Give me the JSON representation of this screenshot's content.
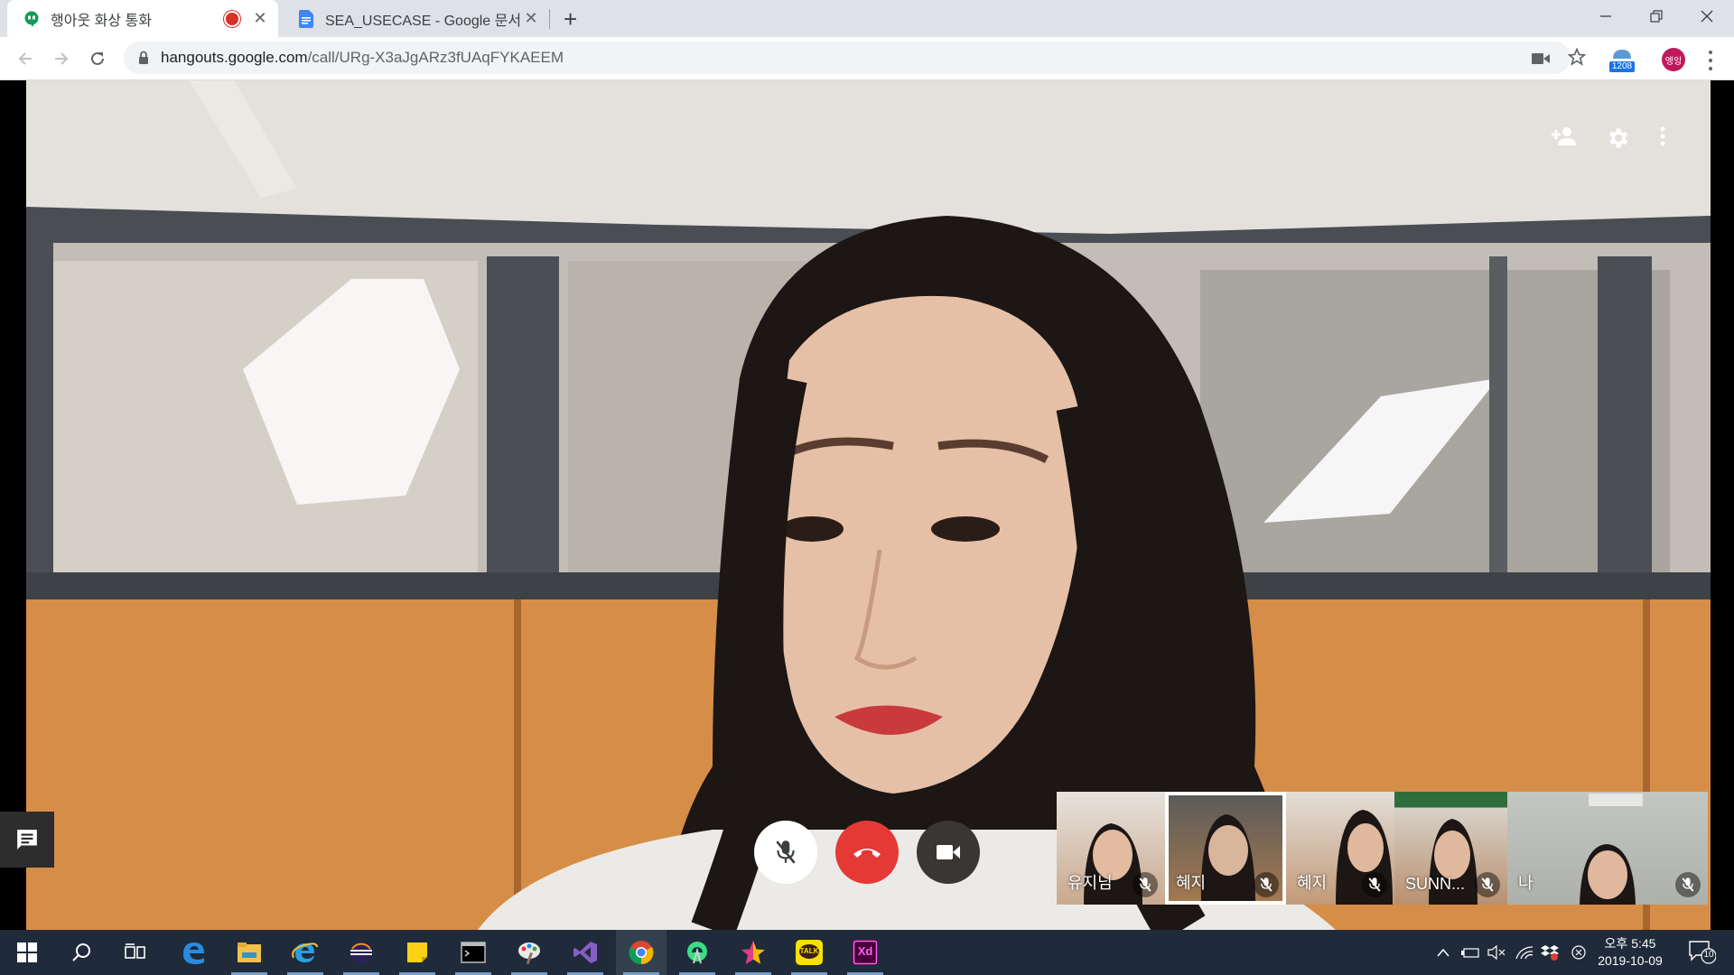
{
  "browser": {
    "tabs": [
      {
        "title": "행아웃 화상 통화",
        "icon": "hangouts-icon",
        "recording": true,
        "active": true
      },
      {
        "title": "SEA_USECASE - Google 문서",
        "icon": "google-docs-icon",
        "active": false
      }
    ],
    "url_host": "hangouts.google.com",
    "url_path": "/call/URg-X3aJgARz3fUAqFYKAEEM",
    "extension_badge": "1208",
    "profile_label": "엥잉"
  },
  "call": {
    "top_actions": [
      "add-person-icon",
      "settings-icon",
      "more-vert-icon"
    ],
    "controls": [
      "mic-off-icon",
      "hang-up-icon",
      "camera-icon"
    ],
    "participants": [
      {
        "name": "유지님",
        "muted": true,
        "active": false
      },
      {
        "name": "혜지",
        "muted": true,
        "active": true
      },
      {
        "name": "혜지",
        "muted": true,
        "active": false
      },
      {
        "name": "SUNN...",
        "muted": true,
        "active": false
      },
      {
        "name": "나",
        "muted": true,
        "active": false
      }
    ]
  },
  "taskbar": {
    "apps": [
      "start-icon",
      "search-icon",
      "task-view-icon",
      "edge-icon",
      "file-explorer-icon",
      "internet-explorer-icon",
      "eclipse-icon",
      "sticky-notes-icon",
      "terminal-icon",
      "paint-icon",
      "visual-studio-icon",
      "chrome-icon",
      "android-studio-icon",
      "star-app-icon",
      "kakaotalk-icon",
      "adobe-xd-icon"
    ],
    "kakao_label": "TALK",
    "xd_label": "Xd",
    "time": "오후 5:45",
    "date": "2019-10-09",
    "notification_count": "10"
  },
  "colors": {
    "hangup_red": "#e53935",
    "accent_blue": "#1a73e8",
    "taskbar": "#1f2b3a"
  }
}
